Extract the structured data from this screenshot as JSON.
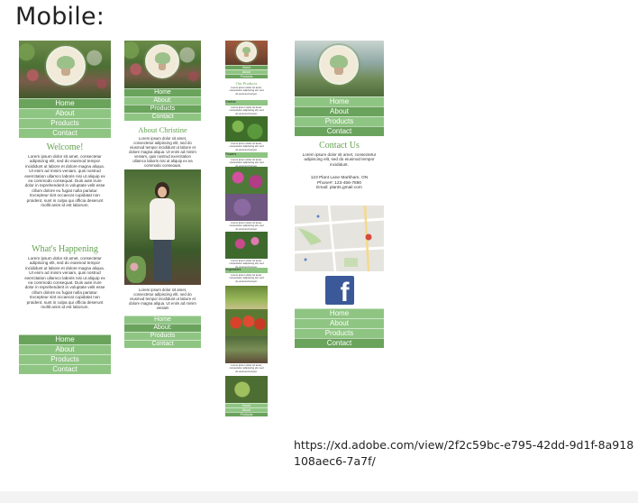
{
  "page": {
    "heading": "Mobile:",
    "prototype_url": "https://xd.adobe.com/view/2f2c59bc-e795-42dd-9d1f-8a918108aec6-7a7f/"
  },
  "nav": [
    "Home",
    "About",
    "Products",
    "Contact"
  ],
  "nav_about_alt": "About:",
  "colors": {
    "accent": "#63a14e",
    "nav_dark": "#6aa35c",
    "nav_light": "#8fc583"
  },
  "home": {
    "welcome_title": "Welcome!",
    "welcome_text": "Lorem ipsum dolor sit amet, consectetur adipiscing elit, sed do eiusmod tempor incididunt ut labore et dolore magna aliqua. Ut enim ad minim veniam, quis nostrud exercitation ullamco laboris nisi ut aliquip ex ea commodo consequat. Duis aute irure dolor in reprehenderit in voluptate velit esse cillum dolore eu fugiat nulla pariatur. Excepteur sint occaecat cupidatat non proident, sunt in culpa qui officia deserunt mollit anim id est laborum.",
    "happening_title": "What's Happening",
    "happening_text": "Lorem ipsum dolor sit amet, consectetur adipiscing elit, sed do eiusmod tempor incididunt ut labore et dolore magna aliqua. Ut enim ad minim veniam, quis nostrud exercitation ullamco laboris nisi ut aliquip ex ea commodo consequat. Duis aute irure dolor in reprehenderit in voluptate velit esse cillum dolore eu fugiat nulla pariatur. Excepteur sint occaecat cupidatat non proident, sunt in culpa qui officia deserunt mollit anim id est laborum."
  },
  "about": {
    "title": "About Christine",
    "text_top": "Lorem ipsum dolor sit amet, consectetur adipiscing elit, sed do eiusmod tempor incididunt ut labore et dolore magna aliqua. Ut enim ad minim veniam, quis nostrud exercitation ullamco laboris nisi ut aliquip ex ea commodo consequat.",
    "text_bottom": "Lorem ipsum dolor sit amet, consectetur adipiscing elit, sed do eiusmod tempor incididunt ut labore et dolore magna aliqua. Ut enim ad minim veniam"
  },
  "products": {
    "title": "Our Products",
    "sections": [
      "Greens",
      "Flowers",
      "Vegetables"
    ],
    "blurb": "Lorem ipsum dolor sit amet, consectetur adipiscing elit, sed do eiusmod tempor."
  },
  "contact": {
    "title": "Contact Us",
    "intro": "Lorem ipsum dolor sit amet, consectetur adipiscing elit, sed do eiusmod tempor incididunt.",
    "address": "123 Plant Lane Markham, ON",
    "phone": "Phone#: 123-456-7890",
    "email": "Email: plants.gmail.com",
    "facebook_glyph": "f"
  }
}
